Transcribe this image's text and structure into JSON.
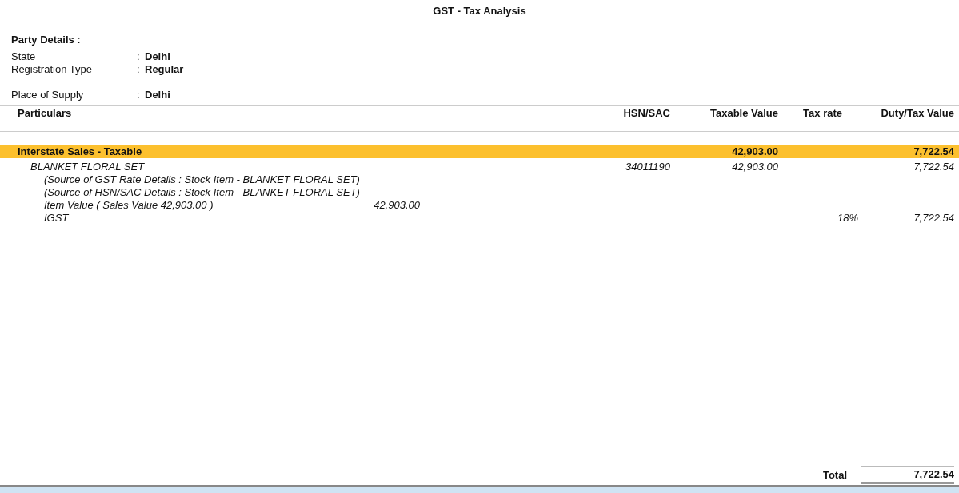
{
  "title": "GST - Tax Analysis",
  "party": {
    "heading": "Party Details :",
    "field_groups": [
      [
        {
          "label": "State",
          "separator": ":",
          "value": "Delhi"
        },
        {
          "label": "Registration Type",
          "separator": ":",
          "value": "Regular"
        }
      ],
      [
        {
          "label": "Place of Supply",
          "separator": ":",
          "value": "Delhi"
        }
      ]
    ]
  },
  "columns": [
    "Particulars",
    "HSN/SAC",
    "Taxable Value",
    "Tax rate",
    "Duty/Tax Value"
  ],
  "rows": [
    {
      "kind": "group",
      "particulars": "Interstate Sales - Taxable",
      "taxable_value": "42,903.00",
      "duty_value": "7,722.54"
    },
    {
      "kind": "item",
      "particulars": "BLANKET FLORAL SET",
      "hsn": "34011190",
      "taxable_value": "42,903.00",
      "duty_value": "7,722.54",
      "details": [
        {
          "text": "(Source of GST Rate Details : Stock Item - BLANKET FLORAL SET)"
        },
        {
          "text": "(Source of HSN/SAC Details : Stock Item - BLANKET FLORAL SET)"
        },
        {
          "text": "Item Value ( Sales Value 42,903.00 )",
          "amount": "42,903.00"
        },
        {
          "text": "IGST",
          "tax_rate": "18%",
          "duty_value": "7,722.54"
        }
      ]
    }
  ],
  "total": {
    "label": "Total",
    "value": "7,722.54"
  }
}
